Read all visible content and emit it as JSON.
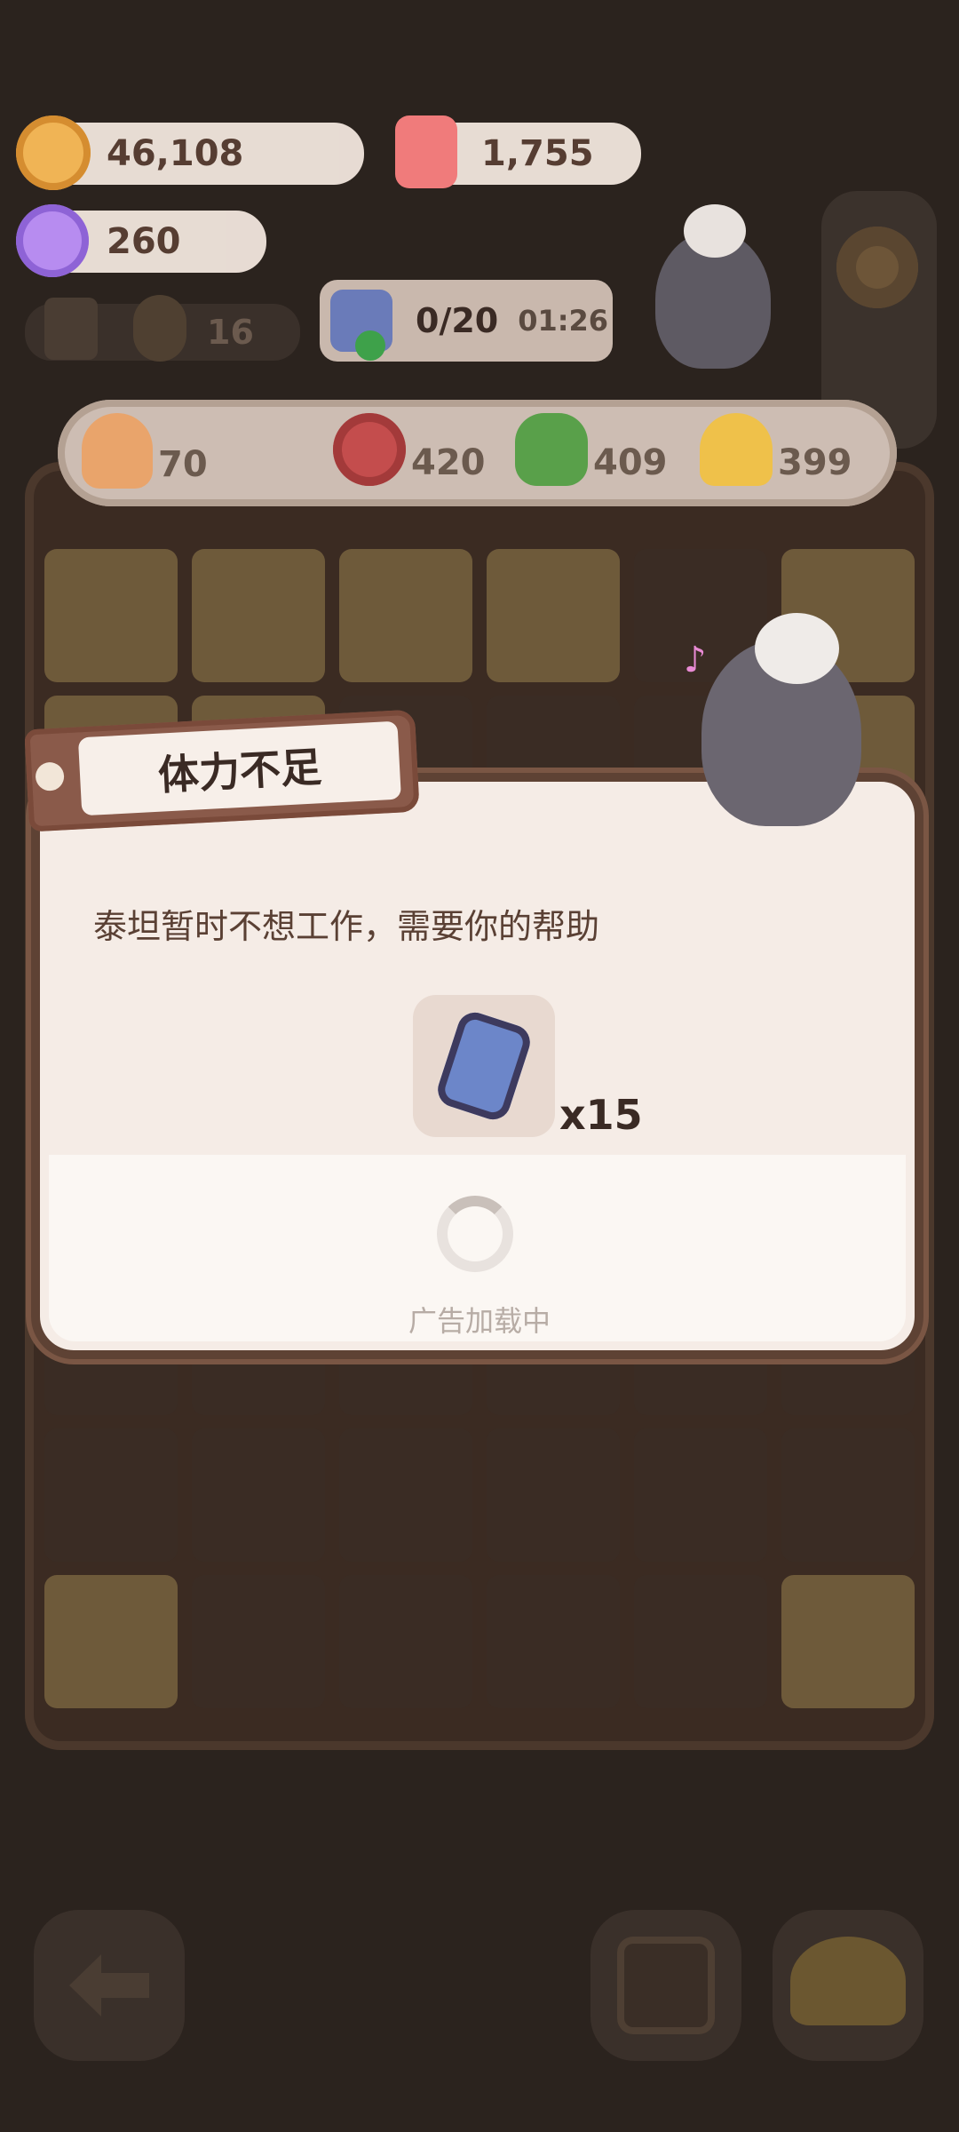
{
  "resources": {
    "cookies": "46,108",
    "candle": "1,755",
    "gems": "260",
    "speaker_count": "16"
  },
  "energy": {
    "count": "0/20",
    "timer": "01:26"
  },
  "ingredients": [
    {
      "icon": "feather-icon",
      "value": "70"
    },
    {
      "icon": "meat-icon",
      "value": "420"
    },
    {
      "icon": "broccoli-icon",
      "value": "409"
    },
    {
      "icon": "cheese-icon",
      "value": "399"
    }
  ],
  "dialog": {
    "title": "体力不足",
    "message": "泰坦暂时不想工作，需要你的帮助",
    "reward_qty": "x15",
    "loading_text": "广告加载中"
  },
  "colors": {
    "accent": "#8a5a4a",
    "panel": "#f5ece6",
    "text": "#5a4034"
  }
}
